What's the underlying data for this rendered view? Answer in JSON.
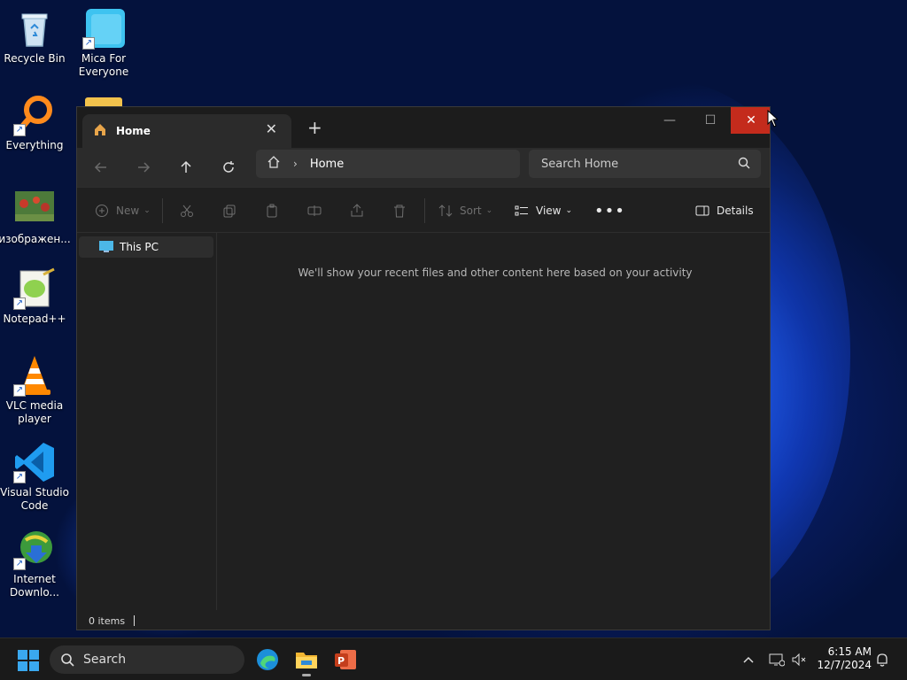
{
  "desktop": {
    "icons": [
      {
        "label": "Recycle Bin",
        "icon": "recycle-bin-icon"
      },
      {
        "label": "Mica For Everyone",
        "icon": "mica-app-icon"
      },
      {
        "label": "Everything",
        "icon": "everything-search-icon"
      },
      {
        "label": "изображен...",
        "icon": "image-file-icon"
      },
      {
        "label": "Notepad++",
        "icon": "notepad-plus-plus-icon"
      },
      {
        "label": "VLC media player",
        "icon": "vlc-cone-icon"
      },
      {
        "label": "Visual Studio Code",
        "icon": "vscode-icon"
      },
      {
        "label": "Internet Downlo...",
        "icon": "internet-download-manager-icon"
      }
    ]
  },
  "explorer": {
    "tab_label": "Home",
    "address_text": "Home",
    "search_placeholder": "Search Home",
    "toolbar": {
      "new_label": "New",
      "sort_label": "Sort",
      "view_label": "View",
      "details_label": "Details"
    },
    "sidebar": {
      "this_pc_label": "This PC"
    },
    "empty_message": "We'll show your recent files and other content here based on your activity",
    "status_items": "0 items"
  },
  "taskbar": {
    "search_label": "Search",
    "time": "6:15 AM",
    "date": "12/7/2024"
  },
  "colors": {
    "close_button": "#c42b1c",
    "window_bg": "#202020",
    "taskbar_bg": "#1a1a1a"
  }
}
